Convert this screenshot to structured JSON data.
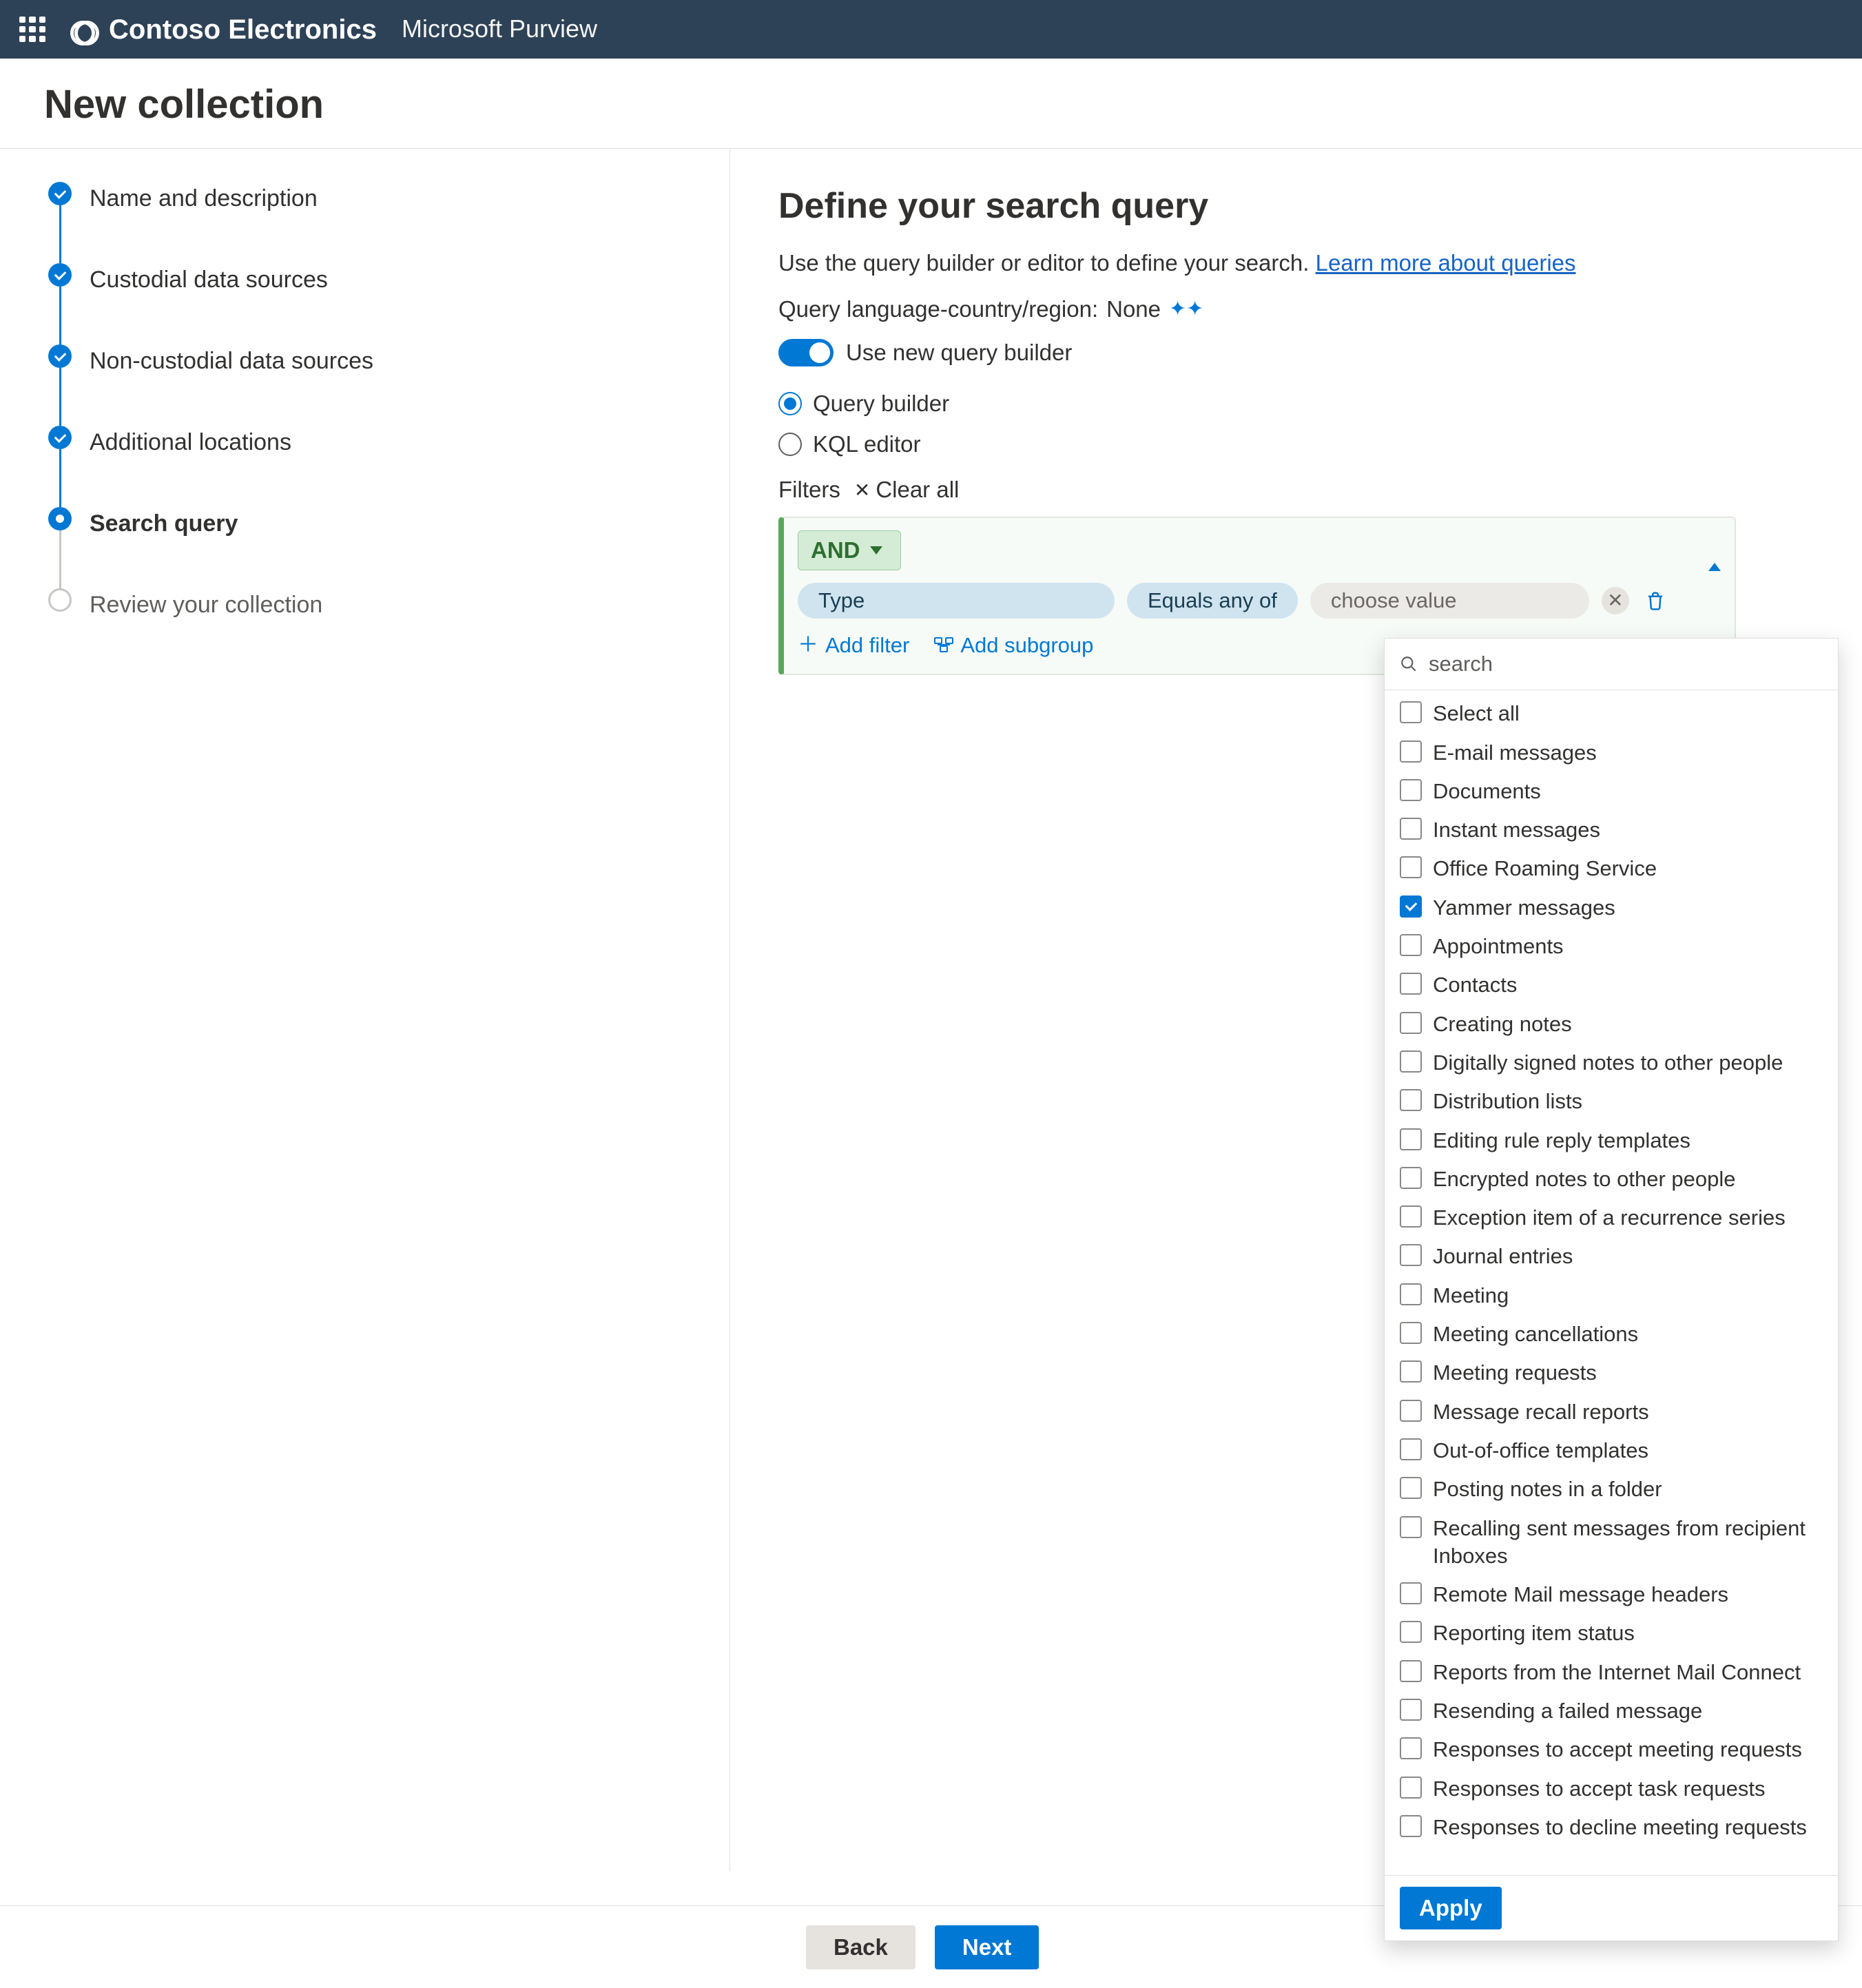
{
  "header": {
    "org_name": "Contoso Electronics",
    "product_name": "Microsoft Purview"
  },
  "page_title": "New collection",
  "stepper": {
    "items": [
      {
        "label": "Name and description",
        "state": "done"
      },
      {
        "label": "Custodial data sources",
        "state": "done"
      },
      {
        "label": "Non-custodial data sources",
        "state": "done"
      },
      {
        "label": "Additional locations",
        "state": "done"
      },
      {
        "label": "Search query",
        "state": "current"
      },
      {
        "label": "Review your collection",
        "state": "future"
      }
    ]
  },
  "search": {
    "title": "Define your search query",
    "helper_text": "Use the query builder or editor to define your search. ",
    "learn_link": "Learn more about queries",
    "lang_label": "Query language-country/region:",
    "lang_value": "None",
    "toggle_label": "Use new query builder",
    "toggle_on": true,
    "options": {
      "builder": "Query builder",
      "kql": "KQL editor",
      "selected": "builder"
    },
    "filters_label": "Filters",
    "clear_all": "Clear all"
  },
  "query_block": {
    "operator": "AND",
    "row": {
      "field": "Type",
      "op": "Equals any of",
      "value_placeholder": "choose value"
    },
    "add_filter": "Add filter",
    "add_subgroup": "Add subgroup"
  },
  "dropdown": {
    "search_placeholder": "search",
    "options": [
      {
        "label": "Select all",
        "checked": false
      },
      {
        "label": "E-mail messages",
        "checked": false
      },
      {
        "label": "Documents",
        "checked": false
      },
      {
        "label": "Instant messages",
        "checked": false
      },
      {
        "label": "Office Roaming Service",
        "checked": false
      },
      {
        "label": "Yammer messages",
        "checked": true
      },
      {
        "label": "Appointments",
        "checked": false
      },
      {
        "label": "Contacts",
        "checked": false
      },
      {
        "label": "Creating notes",
        "checked": false
      },
      {
        "label": "Digitally signed notes to other people",
        "checked": false
      },
      {
        "label": "Distribution lists",
        "checked": false
      },
      {
        "label": "Editing rule reply templates",
        "checked": false
      },
      {
        "label": "Encrypted notes to other people",
        "checked": false
      },
      {
        "label": "Exception item of a recurrence series",
        "checked": false
      },
      {
        "label": "Journal entries",
        "checked": false
      },
      {
        "label": "Meeting",
        "checked": false
      },
      {
        "label": "Meeting cancellations",
        "checked": false
      },
      {
        "label": "Meeting requests",
        "checked": false
      },
      {
        "label": "Message recall reports",
        "checked": false
      },
      {
        "label": "Out-of-office templates",
        "checked": false
      },
      {
        "label": "Posting notes in a folder",
        "checked": false
      },
      {
        "label": "Recalling sent messages from recipient Inboxes",
        "checked": false
      },
      {
        "label": "Remote Mail message headers",
        "checked": false
      },
      {
        "label": "Reporting item status",
        "checked": false
      },
      {
        "label": "Reports from the Internet Mail Connect",
        "checked": false
      },
      {
        "label": "Resending a failed message",
        "checked": false
      },
      {
        "label": "Responses to accept meeting requests",
        "checked": false
      },
      {
        "label": "Responses to accept task requests",
        "checked": false
      },
      {
        "label": "Responses to decline meeting requests",
        "checked": false
      }
    ],
    "apply_label": "Apply"
  },
  "footer": {
    "back": "Back",
    "next": "Next"
  }
}
